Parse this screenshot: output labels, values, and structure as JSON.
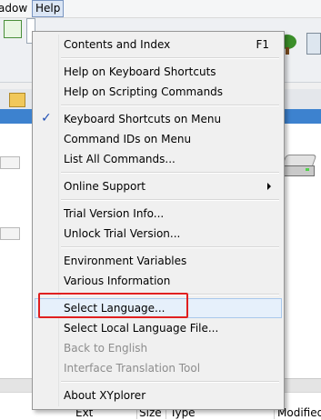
{
  "menubar": {
    "window_label": "adow",
    "help_label": "Help"
  },
  "columns": {
    "ext": "Ext",
    "size": "Size",
    "type": "Type",
    "modified": "Modified"
  },
  "help_menu": {
    "contents": {
      "label": "Contents and Index",
      "shortcut": "F1"
    },
    "keyboard_help": "Help on Keyboard Shortcuts",
    "scripting_help": "Help on Scripting Commands",
    "kbd_on_menu": {
      "label": "Keyboard Shortcuts on Menu",
      "checked": true
    },
    "command_ids": "Command IDs on Menu",
    "list_commands": "List All Commands...",
    "online_support": "Online Support",
    "trial_info": "Trial Version Info...",
    "unlock_trial": "Unlock Trial Version...",
    "env_vars": "Environment Variables",
    "various_info": "Various Information",
    "select_language": "Select Language...",
    "select_local_lang_file": "Select Local Language File...",
    "back_to_english": "Back to English",
    "translation_tool": "Interface Translation Tool",
    "about": "About XYplorer"
  },
  "colors": {
    "highlight": "#e02020",
    "hover_bg": "#e6f0fb",
    "check": "#1f4fb4"
  }
}
